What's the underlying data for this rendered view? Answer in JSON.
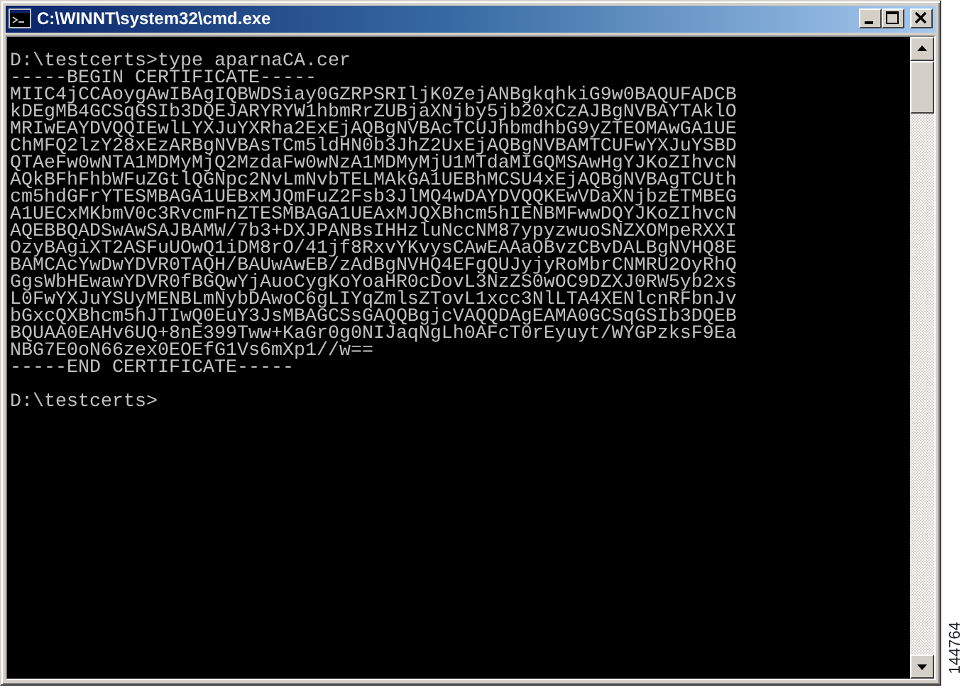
{
  "window": {
    "title": "C:\\WINNT\\system32\\cmd.exe",
    "active": true
  },
  "console": {
    "lines": [
      {
        "text": "D:\\testcerts>type aparnaCA.cer"
      },
      {
        "text": "-----BEGIN CERTIFICATE-----"
      },
      {
        "text": "MIIC4jCCAoygAwIBAgIQBWDSiay0GZRPSRIljK0ZejANBgkqhkiG9w0BAQUFADCB"
      },
      {
        "text": "kDEgMB4GCSqGSIb3DQEJARYRYW1hbmRrZUBjaXNjby5jb20xCzAJBgNVBAYTAklO"
      },
      {
        "text": "MRIwEAYDVQQIEwlLYXJuYXRha2ExEjAQBgNVBAcTCUJhbmdhbG9yZTEOMAwGA1UE"
      },
      {
        "text": "ChMFQ2lzY28xEzARBgNVBAsTCm5ldHN0b3JhZ2UxEjAQBgNVBAMTCUFwYXJuYSBD"
      },
      {
        "text": "QTAeFw0wNTA1MDMyMjQ2MzdaFw0wNzA1MDMyMjU1MTdaMIGQMSAwHgYJKoZIhvcN"
      },
      {
        "text": "AQkBFhFhbWFuZGtlQGNpc2NvLmNvbTELMAkGA1UEBhMCSU4xEjAQBgNVBAgTCUth"
      },
      {
        "text": "cm5hdGFrYTESMBAGA1UEBxMJQmFuZ2Fsb3JlMQ4wDAYDVQQKEwVDaXNjbzETMBEG"
      },
      {
        "text": "A1UECxMKbmV0c3RvcmFnZTESMBAGA1UEAxMJQXBhcm5hIENBMFwwDQYJKoZIhvcN"
      },
      {
        "text": "AQEBBQADSwAwSAJBAMW/7b3+DXJPANBsIHHzluNccNM87ypyzwuoSNZXOMpeRXXI"
      },
      {
        "text": "OzyBAgiXT2ASFuUOwQ1iDM8rO/41jf8RxvYKvysCAwEAAaOBvzCBvDALBgNVHQ8E"
      },
      {
        "text": "BAMCAcYwDwYDVR0TAQH/BAUwAwEB/zAdBgNVHQ4EFgQUJyjyRoMbrCNMRU2OyRhQ"
      },
      {
        "text": "GgsWbHEwawYDVR0fBGQwYjAuoCygKoYoaHR0cDovL3NzZS0wOC9DZXJ0RW5yb2xs"
      },
      {
        "text": "L0FwYXJuYSUyMENBLmNybDAwoC6gLIYqZmlsZTovL1xcc3NlLTA4XENlcnRFbnJv"
      },
      {
        "text": "bGxcQXBhcm5hJTIwQ0EuY3JsMBAGCSsGAQQBgjcVAQQDAgEAMA0GCSqGSIb3DQEB"
      },
      {
        "text": "BQUAA0EAHv6UQ+8nE399Tww+KaGr0g0NIJaqNgLh0AFcT0rEyuyt/WYGPzksF9Ea"
      },
      {
        "text": "NBG7E0oN66zex0EOEfG1Vs6mXp1//w=="
      },
      {
        "text": "-----END CERTIFICATE-----"
      },
      {
        "text": "D:\\testcerts>",
        "blank_before": true
      }
    ]
  },
  "figure_number": "144764"
}
